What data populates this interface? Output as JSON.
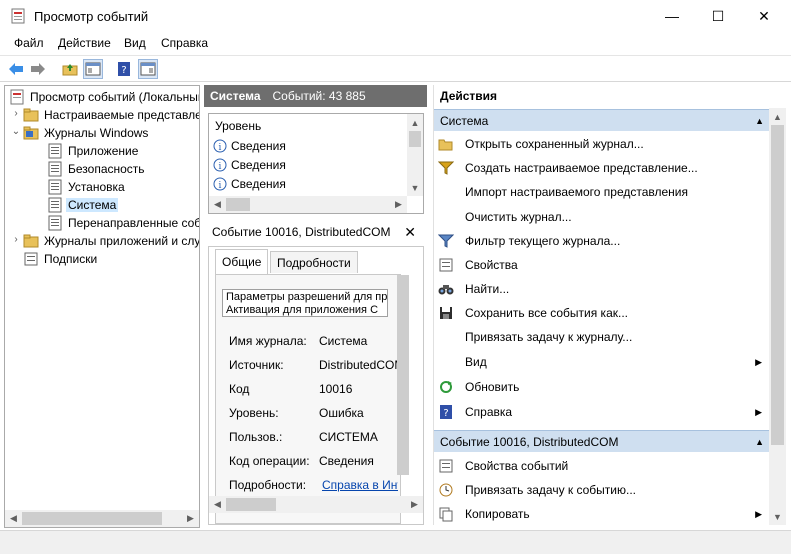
{
  "window": {
    "title": "Просмотр событий",
    "minimize": "—",
    "maximize": "☐",
    "close": "✕"
  },
  "menu": [
    "Файл",
    "Действие",
    "Вид",
    "Справка"
  ],
  "tree": {
    "root": "Просмотр событий (Локальный)",
    "custom_views": "Настраиваемые представления",
    "windows_logs": "Журналы Windows",
    "application": "Приложение",
    "security": "Безопасность",
    "setup": "Установка",
    "system": "Система",
    "forwarded": "Перенаправленные события",
    "app_logs": "Журналы приложений и служб",
    "subscriptions": "Подписки"
  },
  "middle": {
    "log_name": "Система",
    "events_count": "Событий: 43 885",
    "column_level": "Уровень",
    "rows": [
      "Сведения",
      "Сведения",
      "Сведения"
    ],
    "event_title": "Событие 10016, DistributedCOM",
    "tab_general": "Общие",
    "tab_details": "Подробности",
    "description": "Параметры разрешений для приложения\nАктивация для приложения С",
    "fields": [
      {
        "label": "Имя журнала:",
        "value": "Система"
      },
      {
        "label": "Источник:",
        "value": "DistributedCOM"
      },
      {
        "label": "Код",
        "value": "10016"
      },
      {
        "label": "Уровень:",
        "value": "Ошибка"
      },
      {
        "label": "Пользов.:",
        "value": "СИСТЕМА"
      },
      {
        "label": "Код операции:",
        "value": "Сведения"
      },
      {
        "label": "Подробности:",
        "value": "Справка в Интернете"
      }
    ]
  },
  "actions": {
    "header": "Действия",
    "section1": "Система",
    "section1_items": [
      "Открыть сохраненный журнал...",
      "Создать настраиваемое представление...",
      "Импорт настраиваемого представления",
      "Очистить журнал...",
      "Фильтр текущего журнала...",
      "Свойства",
      "Найти...",
      "Сохранить все события как...",
      "Привязать задачу к журналу...",
      "Вид",
      "Обновить",
      "Справка"
    ],
    "section2": "Событие 10016, DistributedCOM",
    "section2_items": [
      "Свойства событий",
      "Привязать задачу к событию...",
      "Копировать"
    ]
  },
  "colors": {
    "accent": "#cfdff0",
    "header_gray": "#6e6e6e",
    "link": "#0645ad"
  }
}
